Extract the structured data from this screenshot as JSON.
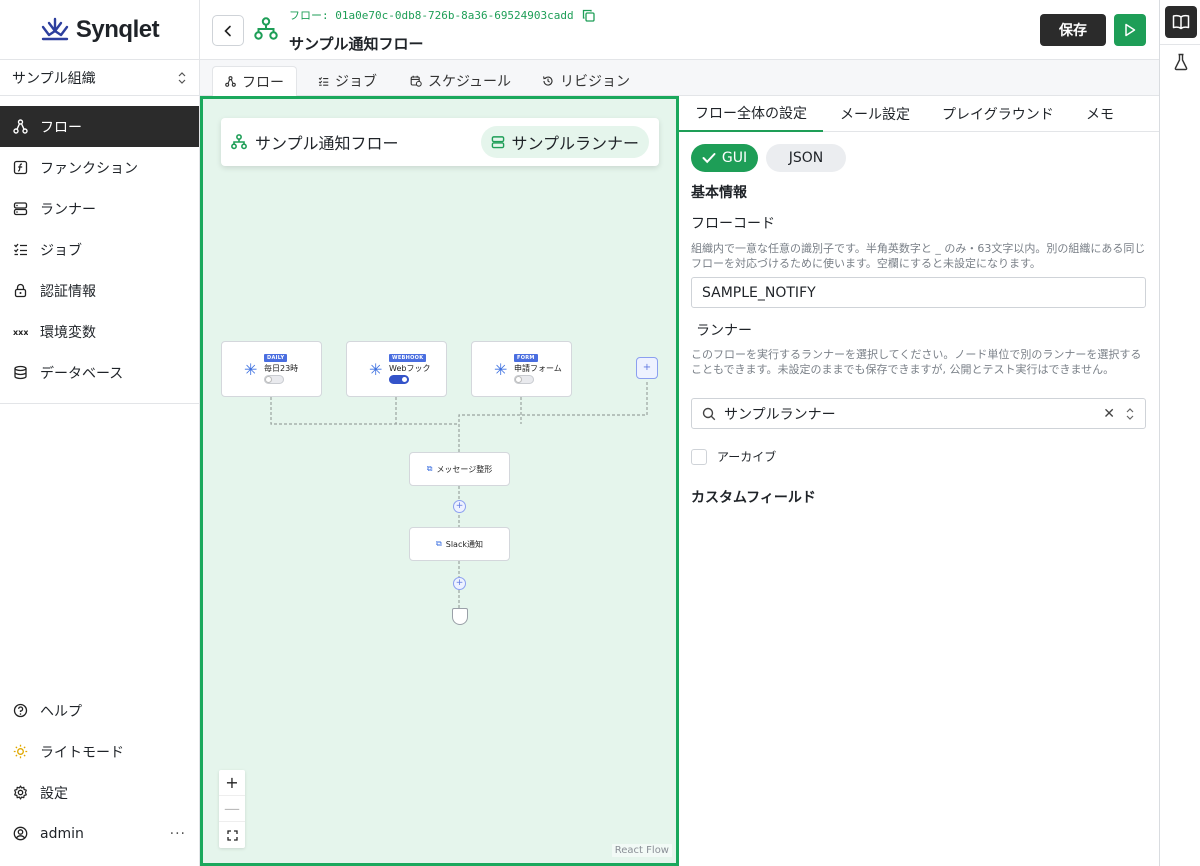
{
  "brand": {
    "name": "Synqlet"
  },
  "org": {
    "selected": "サンプル組織"
  },
  "sidebar": {
    "items": [
      {
        "label": "フロー",
        "icon": "flow-icon"
      },
      {
        "label": "ファンクション",
        "icon": "function-icon"
      },
      {
        "label": "ランナー",
        "icon": "server-icon"
      },
      {
        "label": "ジョブ",
        "icon": "checklist-icon"
      },
      {
        "label": "認証情報",
        "icon": "lock-icon"
      },
      {
        "label": "環境変数",
        "icon": "variable-icon"
      },
      {
        "label": "データベース",
        "icon": "database-icon"
      }
    ],
    "bottom": [
      {
        "label": "ヘルプ",
        "icon": "help-icon"
      },
      {
        "label": "ライトモード",
        "icon": "sun-icon"
      },
      {
        "label": "設定",
        "icon": "gear-icon"
      },
      {
        "label": "admin",
        "icon": "user-icon"
      }
    ],
    "more_label": "···"
  },
  "header": {
    "flow_id_prefix": "フロー:",
    "flow_id": "01a0e70c-0db8-726b-8a36-69524903cadd",
    "title": "サンプル通知フロー",
    "save_label": "保存"
  },
  "tabs": [
    "フロー",
    "ジョブ",
    "スケジュール",
    "リビジョン"
  ],
  "canvas": {
    "flow_name": "サンプル通知フロー",
    "runner_name": "サンプルランナー",
    "triggers": [
      {
        "badge": "DAILY",
        "label": "毎日23時",
        "enabled": false
      },
      {
        "badge": "WEBHOOK",
        "label": "Webフック",
        "enabled": true
      },
      {
        "badge": "FORM",
        "label": "申請フォーム",
        "enabled": false
      }
    ],
    "actions": [
      "メッセージ整形",
      "Slack通知"
    ],
    "add_symbol": "+",
    "zoom_in": "+",
    "zoom_out": "—",
    "attribution": "React Flow"
  },
  "panel": {
    "tabs": [
      "フロー全体の設定",
      "メール設定",
      "プレイグラウンド",
      "メモ"
    ],
    "mode_gui": "GUI",
    "mode_json": "JSON",
    "basic_info": "基本情報",
    "flow_code_label": "フローコード",
    "flow_code_help": "組織内で一意な任意の識別子です。半角英数字と _ のみ・63文字以内。別の組織にある同じフローを対応づけるために使います。空欄にすると未設定になります。",
    "flow_code_value": "SAMPLE_NOTIFY",
    "runner_label": "ランナー",
    "runner_help": "このフローを実行するランナーを選択してください。ノード単位で別のランナーを選択することもできます。未設定のままでも保存できますが, 公開とテスト実行はできません。",
    "runner_value": "サンプルランナー",
    "clear_symbol": "✕",
    "archive_label": "アーカイブ",
    "custom_fields": "カスタムフィールド"
  },
  "colors": {
    "accent": "#1e9e57",
    "dark": "#2b2b2b",
    "canvas": "#e5f5ec",
    "node_blue": "#3b6fe0"
  }
}
